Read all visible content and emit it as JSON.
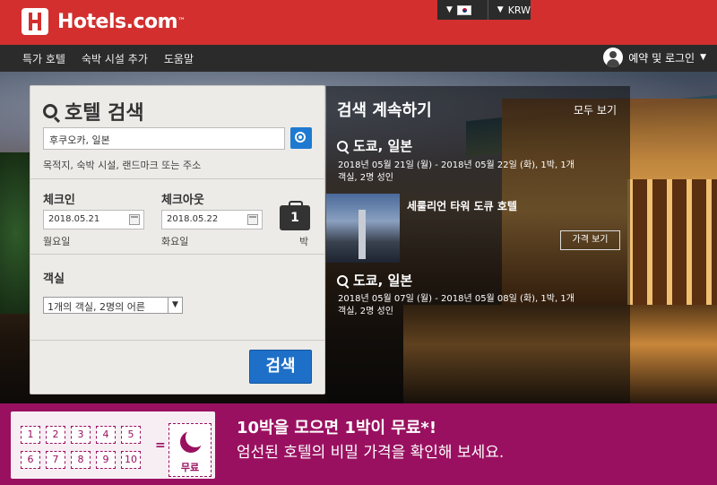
{
  "header": {
    "brand": "Hotels.com",
    "brand_tm": "™",
    "currency": "KRW",
    "colors": {
      "brand_red": "#d32f2f",
      "nav_bg": "#2b2b2b",
      "accent_blue": "#1e6fc8",
      "promo_magenta": "#9a1060"
    }
  },
  "nav": {
    "items": [
      "특가 호텔",
      "숙박 시설 추가",
      "도움말"
    ],
    "login": "예약 및 로그인"
  },
  "search": {
    "title": "호텔 검색",
    "destination": "후쿠오카, 일본",
    "destination_hint": "목적지, 숙박 시설, 랜드마크 또는 주소",
    "checkin_label": "체크인",
    "checkout_label": "체크아웃",
    "checkin_date": "2018.05.21",
    "checkout_date": "2018.05.22",
    "checkin_day": "월요일",
    "checkout_day": "화요일",
    "nights": "1",
    "nights_unit": "박",
    "rooms_label": "객실",
    "rooms_value": "1개의 객실, 2명의 어른",
    "button": "검색"
  },
  "continue": {
    "title": "검색 계속하기",
    "see_all": "모두 보기",
    "items": [
      {
        "title": "도쿄, 일본",
        "line1": "2018년 05월 21일 (월) - 2018년 05월 22일 (화), 1박, 1개",
        "line2": "객실, 2명 성인"
      },
      {
        "hotel": "세룰리언 타워 도큐 호텔",
        "button": "가격 보기"
      },
      {
        "title": "도쿄, 일본",
        "line1": "2018년 05월 07일 (월) - 2018년 05월 08일 (화), 1박, 1개",
        "line2": "객실, 2명 성인"
      }
    ]
  },
  "promo": {
    "numbers": [
      "1",
      "2",
      "3",
      "4",
      "5",
      "6",
      "7",
      "8",
      "9",
      "10"
    ],
    "equals": "=",
    "free": "무료",
    "headline": "10박을 모으면 1박이 무료*!",
    "subline": "엄선된 호텔의 비밀 가격을 확인해 보세요."
  }
}
